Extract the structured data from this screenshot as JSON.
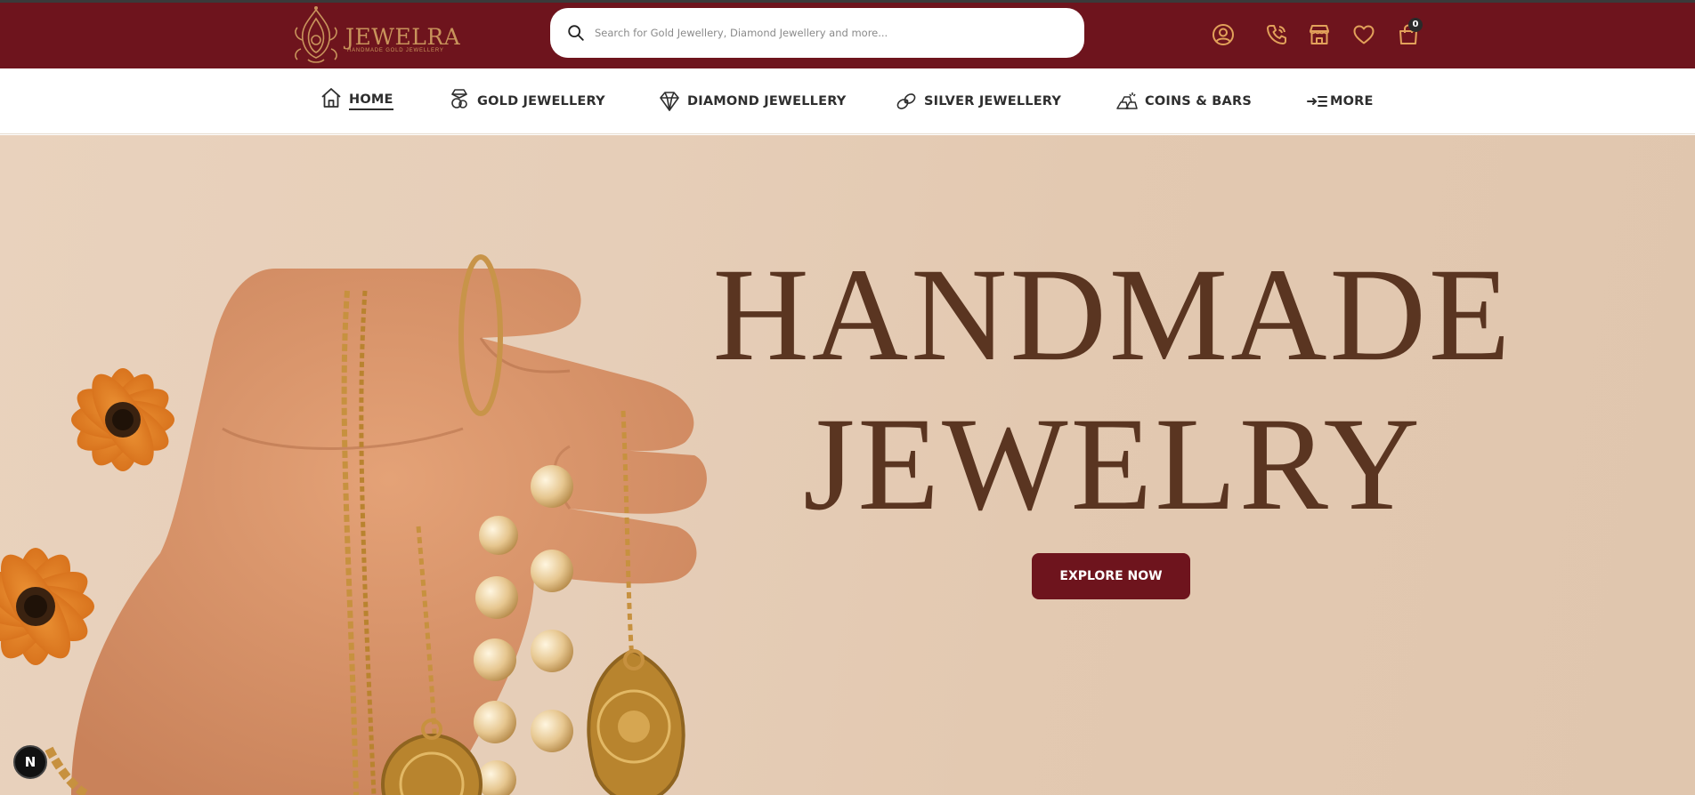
{
  "brand": {
    "name": "JEWELRA",
    "tagline": "HANDMADE GOLD JEWELLERY",
    "logo_icon": "ornate-paisley-logo",
    "primary_color": "#6e141d",
    "gold_color": "#c8935b"
  },
  "search": {
    "placeholder": "Search for Gold Jewellery, Diamond Jewellery and more...",
    "value": "",
    "icon": "search-icon"
  },
  "header_icons": [
    {
      "name": "account-icon"
    },
    {
      "name": "phone-icon"
    },
    {
      "name": "store-icon"
    },
    {
      "name": "wishlist-heart-icon"
    },
    {
      "name": "cart-bag-icon"
    }
  ],
  "cart": {
    "count": "0"
  },
  "nav": {
    "items": [
      {
        "label": "HOME",
        "icon": "home-icon",
        "active": true
      },
      {
        "label": "GOLD JEWELLERY",
        "icon": "gold-jewellery-icon"
      },
      {
        "label": "DIAMOND JEWELLERY",
        "icon": "diamond-icon"
      },
      {
        "label": "SILVER JEWELLERY",
        "icon": "silver-jewellery-icon"
      },
      {
        "label": "COINS & BARS",
        "icon": "coins-bars-icon"
      },
      {
        "label": "MORE",
        "icon": "more-menu-icon"
      }
    ]
  },
  "hero": {
    "title_line1": "HANDMADE",
    "title_line2": "JEWELRY",
    "cta_label": "EXPLORE NOW",
    "title_color": "#5a3521"
  },
  "dev_badge": {
    "label": "N"
  }
}
